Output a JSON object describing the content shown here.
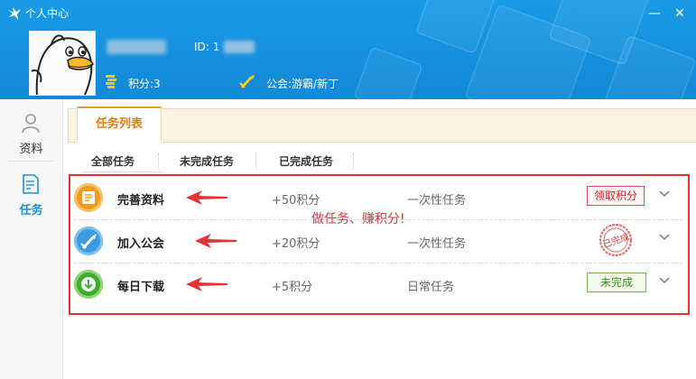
{
  "window": {
    "title": "个人中心",
    "minimize_glyph": "—",
    "close_glyph": "✕",
    "logo_icon": "bird-logo-icon"
  },
  "profile": {
    "avatar_icon": "penguin-avatar",
    "id_label": "ID: 1",
    "points_label": "积分:3",
    "guild_label": "公会:游霸/新丁"
  },
  "sidebar": {
    "items": [
      {
        "label": "资料",
        "icon": "user-icon",
        "active": false
      },
      {
        "label": "任务",
        "icon": "task-doc-icon",
        "active": true
      }
    ]
  },
  "tabs": {
    "main_tab": "任务列表",
    "subtabs": [
      "全部任务",
      "未完成任务",
      "已完成任务"
    ]
  },
  "promo_text": "做任务、赚积分!",
  "tasks": [
    {
      "name": "完善资料",
      "points": "+50积分",
      "type": "一次性任务",
      "status": "领取积分",
      "status_kind": "claim",
      "icon": "profile-card-icon",
      "icon_color": "#f29a1f"
    },
    {
      "name": "加入公会",
      "points": "+20积分",
      "type": "一次性任务",
      "status": "已完成",
      "status_kind": "stamp",
      "icon": "guild-sword-icon",
      "icon_color": "#3b9be0"
    },
    {
      "name": "每日下载",
      "points": "+5积分",
      "type": "日常任务",
      "status": "未完成",
      "status_kind": "incomplete",
      "icon": "download-icon",
      "icon_color": "#3fae2c"
    }
  ],
  "colors": {
    "header_blue": "#1590de",
    "accent_orange": "#f39a1e",
    "annotation_red": "#e23232"
  }
}
